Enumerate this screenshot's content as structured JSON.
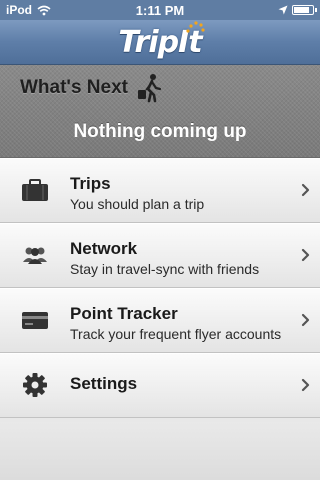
{
  "status_bar": {
    "carrier": "iPod",
    "time": "1:11 PM",
    "icons": [
      "wifi-icon",
      "location-arrow-icon",
      "battery-icon"
    ],
    "battery_level": 0.85
  },
  "nav": {
    "logo_text": "TripIt",
    "colors": {
      "bar": "#5e7ea8",
      "logo": "#ffffff"
    }
  },
  "whats_next": {
    "title": "What's Next",
    "icon": "traveler-with-luggage-icon",
    "message": "Nothing coming up"
  },
  "menu": {
    "items": [
      {
        "title": "Trips",
        "subtitle": "You should plan a trip",
        "icon": "briefcase-icon"
      },
      {
        "title": "Network",
        "subtitle": "Stay in travel-sync with friends",
        "icon": "people-icon"
      },
      {
        "title": "Point Tracker",
        "subtitle": "Track your frequent flyer accounts",
        "icon": "credit-card-icon"
      },
      {
        "title": "Settings",
        "subtitle": "",
        "icon": "gear-icon"
      }
    ],
    "chevron_icon": "chevron-right-icon"
  }
}
